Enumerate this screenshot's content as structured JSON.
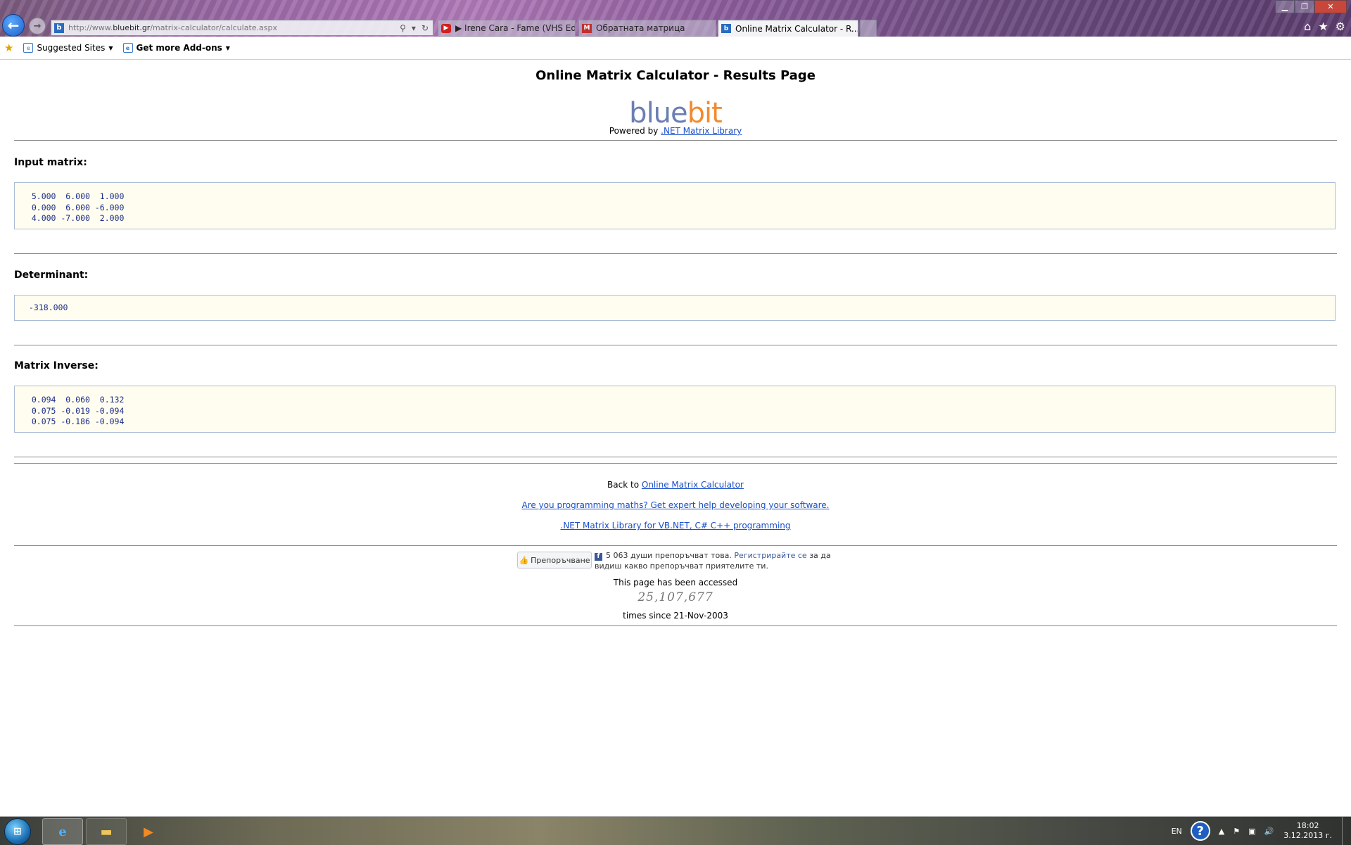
{
  "browser": {
    "url_prefix": "http://www.",
    "url_domain": "bluebit.gr",
    "url_path": "/matrix-calculator/calculate.aspx",
    "tabs": [
      {
        "label": "▶ Irene Cara - Fame (VHS Edit..."
      },
      {
        "label": "Обратната матрица"
      },
      {
        "label": "Online Matrix Calculator - R..."
      }
    ],
    "favorites": {
      "suggested_sites": "Suggested Sites",
      "addons": "Get more Add-ons"
    }
  },
  "page": {
    "title": "Online Matrix Calculator - Results Page",
    "logo_part1": "blue",
    "logo_part2": "bit",
    "powered_by": "Powered by",
    "powered_link": ".NET Matrix Library",
    "input_label": "Input matrix:",
    "input_matrix": [
      "  5.000  6.000  1.000",
      "  0.000  6.000 -6.000",
      "  4.000 -7.000  2.000"
    ],
    "determinant_label": "Determinant:",
    "determinant_value": "-318.000",
    "inverse_label": "Matrix Inverse:",
    "inverse_matrix": [
      "  0.094  0.060  0.132",
      "  0.075 -0.019 -0.094",
      "  0.075 -0.186 -0.094"
    ],
    "back_to_prefix": "Back to",
    "back_link": "Online Matrix Calculator",
    "expert_link": "Are you programming maths? Get expert help developing your software.",
    "library_link": ".NET Matrix Library for VB.NET, C# C++ programming",
    "fb_like": "Препоръчване",
    "fb_count_text": "5 063 души препоръчват това.",
    "fb_register": "Регистрирайте се",
    "fb_rest": "за да видиш какво препоръчват приятелите ти.",
    "accessed_text": "This page has been accessed",
    "counter": "25,107,677",
    "since_text": "times since  21-Nov-2003"
  },
  "taskbar": {
    "lang": "EN",
    "time": "18:02",
    "date": "3.12.2013 г."
  },
  "colors": {
    "logo_blue": "#6b7fb3",
    "logo_orange": "#f28a2e",
    "link": "#1a4fc8",
    "matrix_bg": "#fffdf0",
    "matrix_text": "#1a2d8a"
  }
}
